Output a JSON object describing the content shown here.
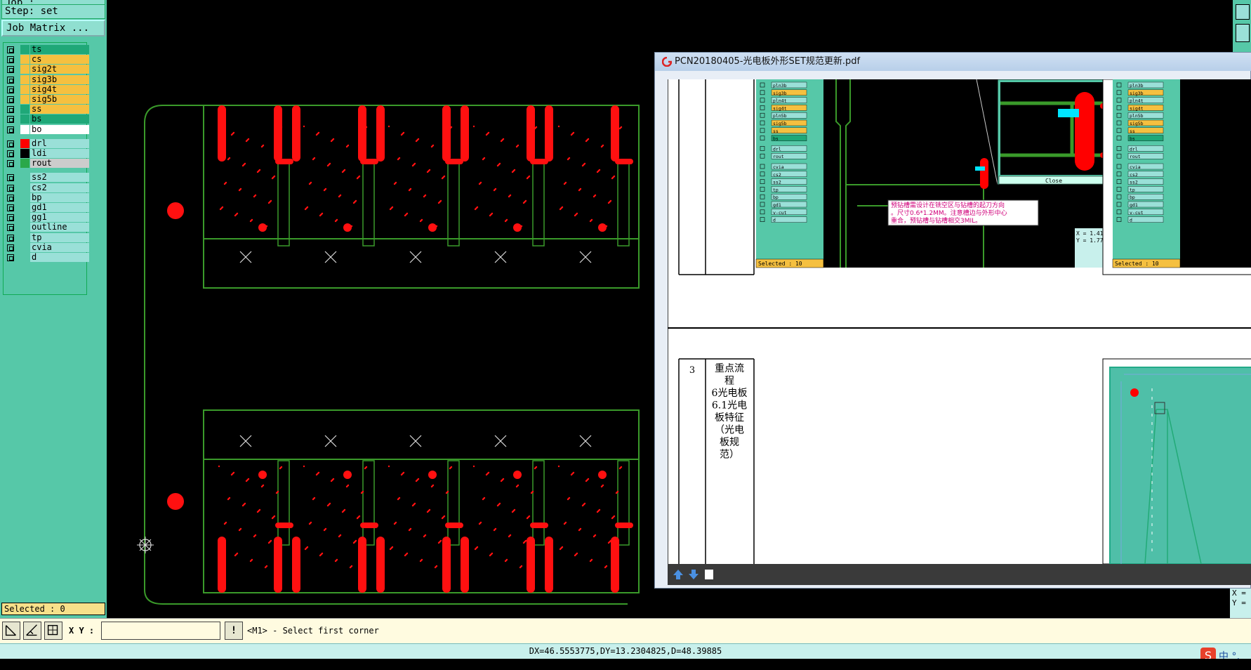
{
  "app": {
    "job_label": "Job : ",
    "step_label": "Step: set",
    "job_matrix_button": "Job Matrix ..."
  },
  "layers": [
    {
      "name": "ts",
      "color": "#1fa878",
      "name_bg": "#1fa878"
    },
    {
      "name": "cs",
      "color": "#f5c040",
      "name_bg": "#f5c040"
    },
    {
      "name": "sig2t",
      "color": "#f5c040",
      "name_bg": "#f5c040"
    },
    {
      "name": "sig3b",
      "color": "#f5c040",
      "name_bg": "#f5c040"
    },
    {
      "name": "sig4t",
      "color": "#f5c040",
      "name_bg": "#f5c040"
    },
    {
      "name": "sig5b",
      "color": "#f5c040",
      "name_bg": "#f5c040"
    },
    {
      "name": "ss",
      "color": "#1fa878",
      "name_bg": "#f5c040"
    },
    {
      "name": "bs",
      "color": "#1fa878",
      "name_bg": "#1fa878"
    },
    {
      "name": "bo",
      "color": "#ffffff",
      "name_bg": "#ffffff"
    },
    {
      "name": "drl",
      "color": "#ff0000",
      "name_bg": "#9ae0d8"
    },
    {
      "name": "ldi",
      "color": "#000000",
      "name_bg": "#9ae0d8"
    },
    {
      "name": "rout",
      "color": "#2aa84a",
      "name_bg": "#cccccc"
    },
    {
      "name": "ss2",
      "color": "#56c8a8",
      "name_bg": "#9ae0d8"
    },
    {
      "name": "cs2",
      "color": "#56c8a8",
      "name_bg": "#9ae0d8"
    },
    {
      "name": "bp",
      "color": "#56c8a8",
      "name_bg": "#9ae0d8"
    },
    {
      "name": "gd1",
      "color": "#56c8a8",
      "name_bg": "#9ae0d8"
    },
    {
      "name": "gg1",
      "color": "#56c8a8",
      "name_bg": "#9ae0d8"
    },
    {
      "name": "outline",
      "color": "#56c8a8",
      "name_bg": "#9ae0d8"
    },
    {
      "name": "tp",
      "color": "#56c8a8",
      "name_bg": "#9ae0d8"
    },
    {
      "name": "cvia",
      "color": "#56c8a8",
      "name_bg": "#9ae0d8"
    },
    {
      "name": "d",
      "color": "#56c8a8",
      "name_bg": "#9ae0d8"
    }
  ],
  "selected_left": "Selected : 0",
  "pdf": {
    "title": "PCN20180405-光电板外形SET规范更新.pdf",
    "annotation_line1": "预钻槽需设计在铣空区与钻槽的起刀方向",
    "annotation_line2": "。尺寸0.6*1.2MM。注意槽边与外形中心",
    "annotation_line3": "重合，预钻槽与钻槽相交3MIL。",
    "close_button": "Close",
    "selected_inner": "Selected : 10",
    "selected_inner2": "Selected : 10",
    "row_number": "3",
    "row_text": [
      "重点流",
      "程",
      "6光电板",
      "6.1光电",
      "板特征",
      "（光电",
      "板规",
      "范）"
    ],
    "coord_x": "X = 1.41",
    "coord_y": "Y = 1.77",
    "inner_layers": [
      "pln3b",
      "sig3b",
      "pln4t",
      "sig4t",
      "pln5b",
      "sig5b",
      "ss",
      "bs",
      "drl",
      "rout",
      "cvia",
      "cs2",
      "ss2",
      "tp",
      "bp",
      "gd1",
      "v-cut",
      "d"
    ]
  },
  "cmd": {
    "xy_label": "X Y :",
    "xy_value": "",
    "prompt": "<M1> - Select first corner"
  },
  "status": "DX=46.5553775,DY=13.2304825,D=48.39885",
  "corner_xy": [
    "X =",
    "Y ="
  ],
  "ime_text": "中 °,"
}
